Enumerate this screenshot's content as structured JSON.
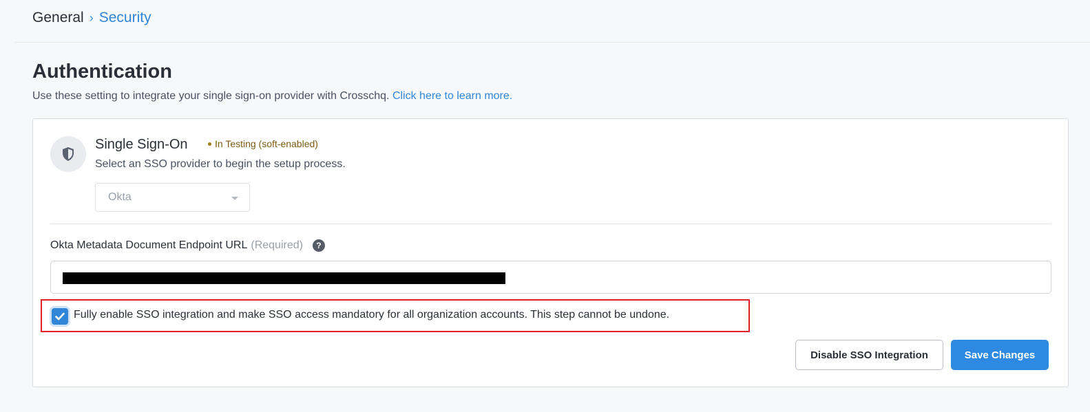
{
  "breadcrumb": {
    "items": [
      {
        "label": "General"
      },
      {
        "label": "Security"
      }
    ]
  },
  "page": {
    "title": "Authentication",
    "subtitle": "Use these setting to integrate your single sign-on provider with Crosschq.",
    "learn_more_link": "Click here to learn more."
  },
  "sso": {
    "icon": "shield-icon",
    "title": "Single Sign-On",
    "status_badge": "In Testing (soft-enabled)",
    "description": "Select an SSO provider to begin the setup process.",
    "provider_selected": "Okta",
    "metadata_field": {
      "label": "Okta Metadata Document Endpoint URL",
      "required_hint": "(Required)",
      "help_icon": "question-circle-icon"
    },
    "enforce_checkbox": {
      "checked": true,
      "label": "Fully enable SSO integration and make SSO access mandatory for all organization accounts. This step cannot be undone."
    },
    "buttons": {
      "disable_label": "Disable SSO Integration",
      "save_label": "Save Changes"
    }
  },
  "colors": {
    "accent": "#2f86d9",
    "primary_button": "#2e89e3",
    "status_badge": "#7a5b12",
    "highlight": "#e0202a"
  }
}
